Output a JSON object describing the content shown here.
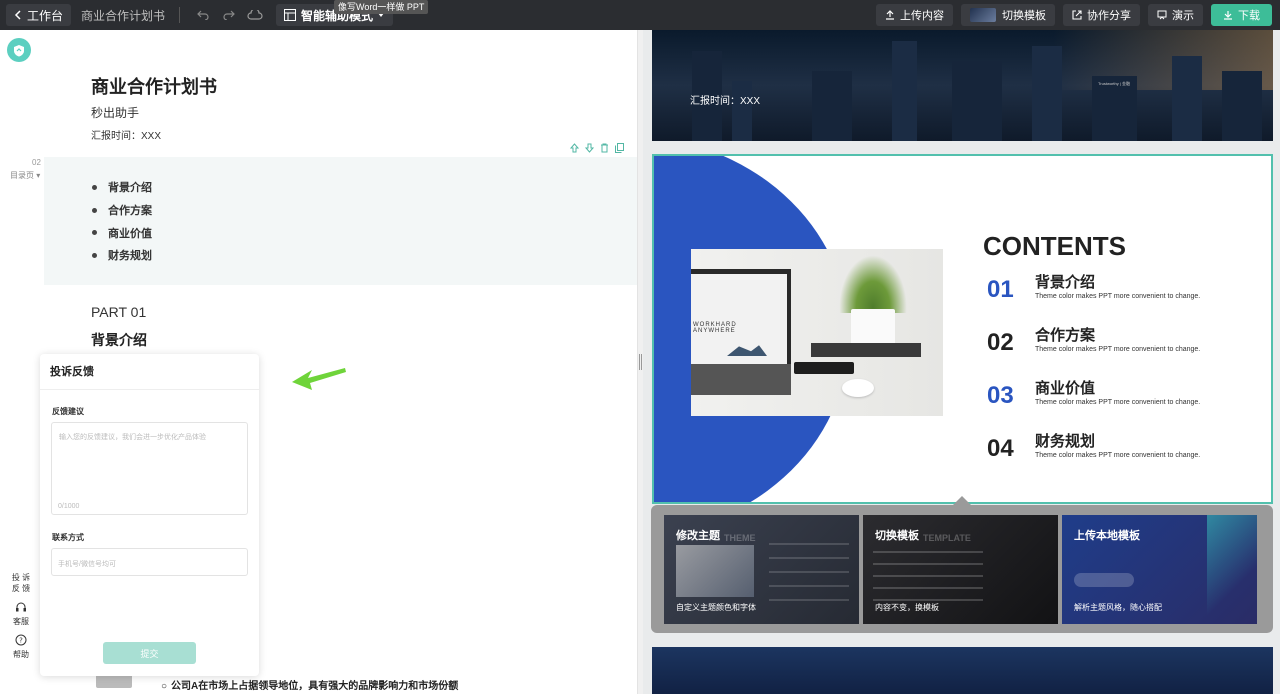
{
  "topbar": {
    "back_label": "工作台",
    "doc_name": "商业合作计划书",
    "mode_label": "智能辅助模式",
    "tooltip": "像写Word一样做 PPT",
    "upload_label": "上传内容",
    "switch_template_label": "切换模板",
    "share_label": "协作分享",
    "present_label": "演示",
    "download_label": "下载"
  },
  "editor": {
    "title": "商业合作计划书",
    "subtitle": "秒出助手",
    "report_time": "汇报时间：XXX",
    "page_num": "02",
    "page_type": "目录页",
    "toc": [
      "背景介绍",
      "合作方案",
      "商业价值",
      "财务规划"
    ],
    "part": "PART 01",
    "part_heading": "背景介绍",
    "bottom_text": "公司A在市场上占据领导地位，具有强大的品牌影响力和市场份额",
    "bottom_bullet": "○"
  },
  "feedback": {
    "title": "投诉反馈",
    "suggestion_label": "反馈建议",
    "suggestion_placeholder": "输入您的反馈建议，我们会进一步优化产品体验",
    "counter": "0/1000",
    "contact_label": "联系方式",
    "contact_placeholder": "手机号/微信号均可",
    "submit_label": "提交"
  },
  "side_helpers": {
    "complaint": "投 诉\n反 馈",
    "service": "客服",
    "help": "帮助"
  },
  "preview": {
    "slide1_time": "汇报时间：XXX",
    "slide1_logo": "Trustworthy | 金融",
    "slide2": {
      "heading": "CONTENTS",
      "laptop_text": "WORKHARD\nANYWHERE",
      "items": [
        {
          "num": "01",
          "title": "背景介绍",
          "desc": "Theme color makes PPT more convenient to change.",
          "color": "#2a55c0"
        },
        {
          "num": "02",
          "title": "合作方案",
          "desc": "Theme color makes PPT more convenient to change.",
          "color": "#222222"
        },
        {
          "num": "03",
          "title": "商业价值",
          "desc": "Theme color makes PPT more convenient to change.",
          "color": "#2a55c0"
        },
        {
          "num": "04",
          "title": "财务规划",
          "desc": "Theme color makes PPT more convenient to change.",
          "color": "#222222"
        }
      ]
    },
    "popup": {
      "cards": [
        {
          "title": "修改主题",
          "desc": "自定义主题颜色和字体",
          "ghost": "THEME"
        },
        {
          "title": "切换模板",
          "desc": "内容不变，换模板",
          "ghost": "TEMPLATE"
        },
        {
          "title": "上传本地模板",
          "desc": "解析主题风格，随心搭配",
          "ghost": ""
        }
      ]
    }
  },
  "colors": {
    "accent": "#3dbd98",
    "topbar": "#2b2d31",
    "slide_blue": "#2a55c0"
  }
}
